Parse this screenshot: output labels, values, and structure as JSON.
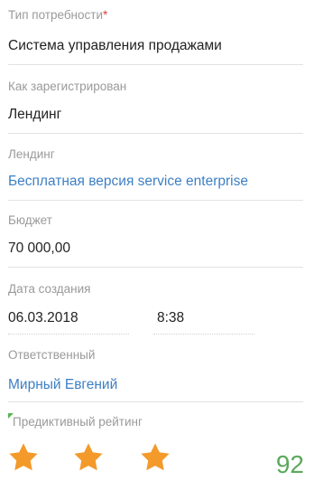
{
  "fields": {
    "need_type": {
      "label": "Тип потребности",
      "required_mark": "*",
      "value": "Система управления продажами"
    },
    "registered_as": {
      "label": "Как зарегистрирован",
      "value": "Лендинг"
    },
    "landing": {
      "label": "Лендинг",
      "value": "Бесплатная версия service enterprise"
    },
    "budget": {
      "label": "Бюджет",
      "value": "70 000,00"
    },
    "created": {
      "label": "Дата создания",
      "date": "06.03.2018",
      "time": "8:38"
    },
    "owner": {
      "label": "Ответственный",
      "value": "Мирный Евгений"
    },
    "rating": {
      "label": "Предиктивный рейтинг",
      "stars_filled": 3,
      "stars_total": 3,
      "score": "92"
    }
  },
  "colors": {
    "label": "#9a9a9a",
    "value": "#222222",
    "link": "#3d7fc3",
    "required": "#e04040",
    "star": "#f39a2b",
    "score": "#5aa95a",
    "corner_marker": "#5ab552"
  },
  "icons": {
    "star": "star-icon",
    "corner": "green-corner-marker"
  }
}
